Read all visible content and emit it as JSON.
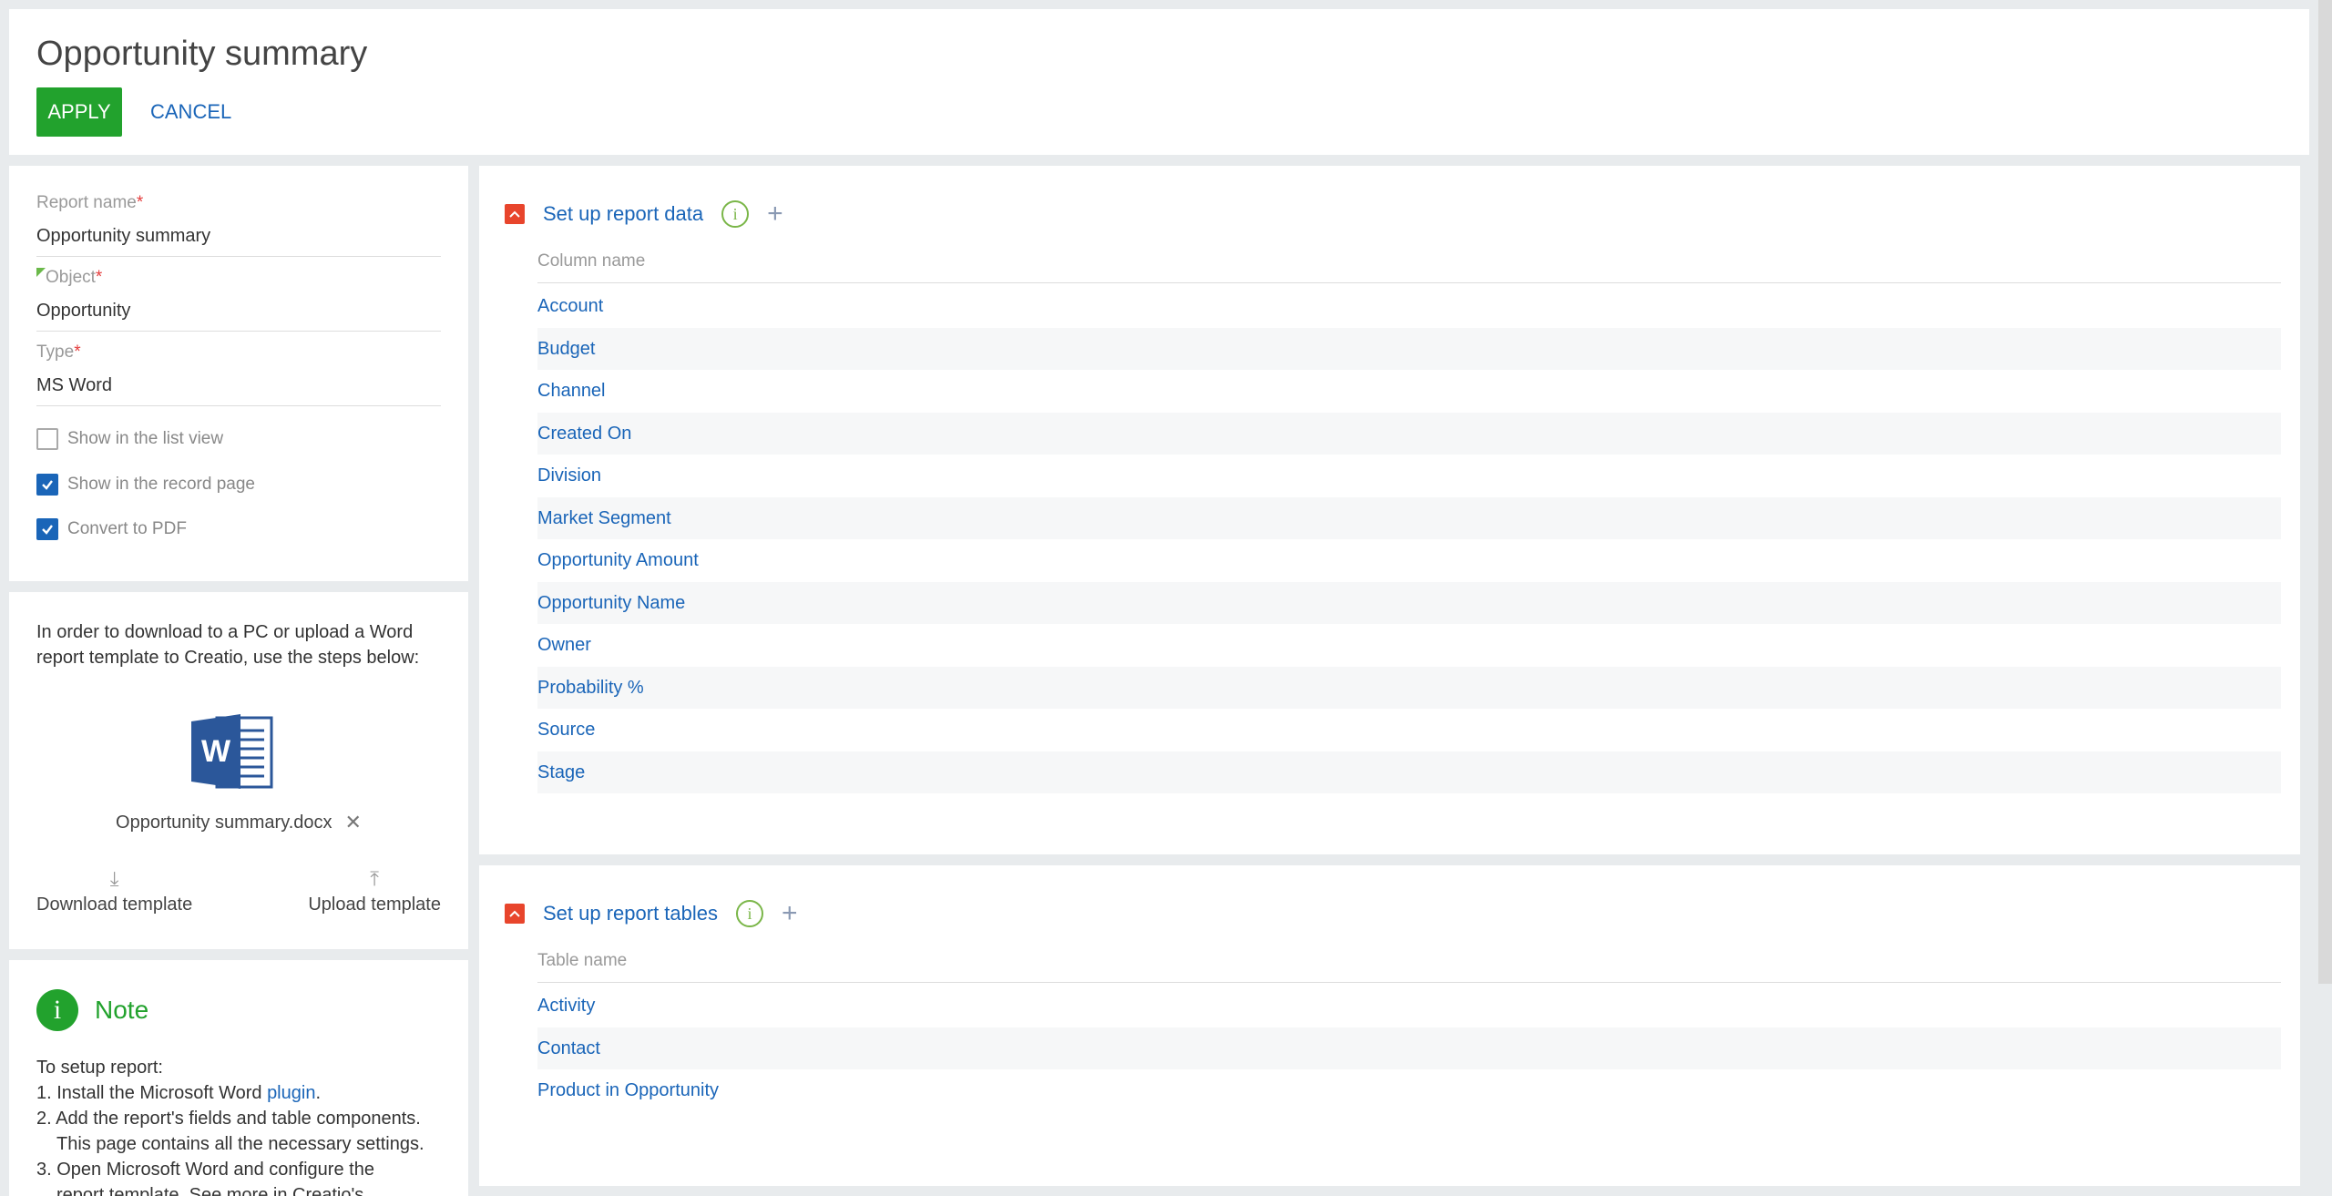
{
  "header": {
    "title": "Opportunity summary",
    "apply_label": "APPLY",
    "cancel_label": "CANCEL"
  },
  "form": {
    "report_name_label": "Report name",
    "report_name_value": "Opportunity summary",
    "object_label": "Object",
    "object_value": "Opportunity",
    "type_label": "Type",
    "type_value": "MS Word",
    "required_mark": "*",
    "checkboxes": [
      {
        "label": "Show in the list view",
        "checked": false
      },
      {
        "label": "Show in the record page",
        "checked": true
      },
      {
        "label": "Convert to PDF",
        "checked": true
      }
    ]
  },
  "template": {
    "instructions": "In order to download to a PC or upload a Word report template to Creatio, use the steps below:",
    "file_name": "Opportunity summary.docx",
    "download_label": "Download template",
    "upload_label": "Upload template"
  },
  "note": {
    "title": "Note",
    "intro": "To setup report:",
    "step1_prefix": "1. Install the Microsoft Word ",
    "step1_link": "plugin",
    "step1_suffix": ".",
    "step2": "2. Add the report's fields and table components.",
    "step2_cont": "This page contains all the necessary settings.",
    "step3": "3. Open Microsoft Word and configure the",
    "step3_cont": "report template. See more in Creatio's"
  },
  "report_data": {
    "title": "Set up report data",
    "column_header": "Column name",
    "columns": [
      "Account",
      "Budget",
      "Channel",
      "Created On",
      "Division",
      "Market Segment",
      "Opportunity Amount",
      "Opportunity Name",
      "Owner",
      "Probability %",
      "Source",
      "Stage"
    ]
  },
  "report_tables": {
    "title": "Set up report tables",
    "column_header": "Table name",
    "tables": [
      "Activity",
      "Contact",
      "Product in Opportunity"
    ]
  },
  "colors": {
    "accent": "#1a65b8",
    "apply_green": "#22a22d",
    "collapse_red": "#e8452c"
  }
}
